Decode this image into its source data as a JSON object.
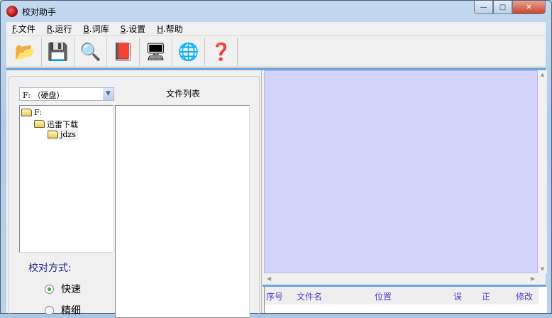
{
  "window": {
    "title": "校对助手",
    "controls": {
      "minimize": "—",
      "maximize": "□",
      "close": "✕"
    }
  },
  "menu": [
    {
      "key": "F",
      "label": ".文件"
    },
    {
      "key": "R",
      "label": ".运行"
    },
    {
      "key": "B",
      "label": ".词库"
    },
    {
      "key": "S",
      "label": ".设置"
    },
    {
      "key": "H",
      "label": ".帮助"
    }
  ],
  "toolbar": [
    {
      "name": "open-folder",
      "glyph": "📂"
    },
    {
      "name": "save",
      "glyph": "💾"
    },
    {
      "name": "search-dictionary",
      "glyph": "🔍"
    },
    {
      "name": "red-book",
      "glyph": "📕"
    },
    {
      "name": "computer",
      "glyph": "🖥"
    },
    {
      "name": "network",
      "glyph": "🌐"
    },
    {
      "name": "help-book",
      "glyph": "❓"
    }
  ],
  "left": {
    "drive": "F: （硬盘）",
    "tree": [
      "F:",
      "迅雷下载",
      "jdzs"
    ],
    "file_list_label": "文件列表",
    "mode_label": "校对方式:",
    "modes": [
      {
        "label": "快速",
        "checked": true
      },
      {
        "label": "精细",
        "checked": false
      }
    ]
  },
  "results": {
    "columns": [
      "序号",
      "文件名",
      "位置",
      "误",
      "正",
      "修改"
    ]
  }
}
